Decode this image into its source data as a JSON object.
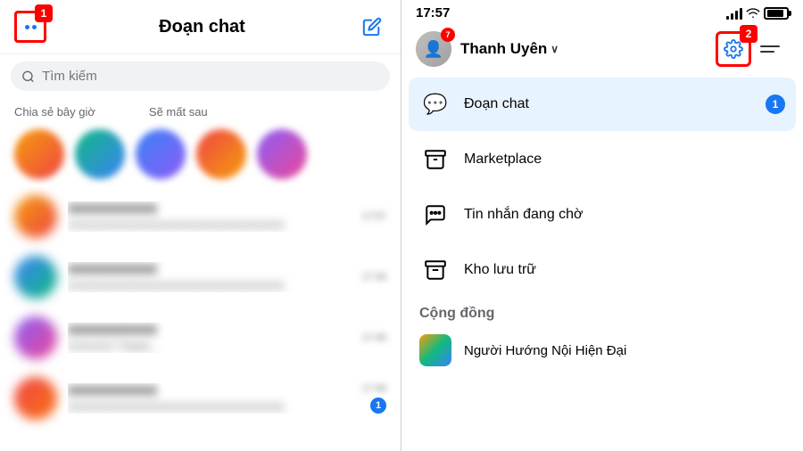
{
  "left": {
    "title": "Đoạn chat",
    "menu_badge": "1",
    "search_placeholder": "Tìm kiếm",
    "story_labels": [
      "Chia sẻ bây giờ",
      "Sẽ mất sau"
    ],
    "chat_items": [
      {
        "name": "xxxxxx",
        "preview": "xxxxxxxxxxxxxxxxxxxxxx",
        "time": "17:57",
        "unread": false
      },
      {
        "name": "xxxxxx",
        "preview": "xxxxxxxxxxxxxxxxxxxxxx",
        "time": "17:46",
        "unread": false
      },
      {
        "name": "xxxxxx",
        "preview": "xxxxxx Thành...",
        "time": "17:46",
        "unread": false
      },
      {
        "name": "xxxxxx",
        "preview": "xxxxxxxxxxxxxxxxxxxxxx",
        "time": "17:46",
        "unread": true
      }
    ]
  },
  "right": {
    "time": "17:57",
    "user_name": "Thanh Uyên",
    "user_badge": "7",
    "chevron": "∨",
    "nav_items": [
      {
        "icon": "💬",
        "label": "Đoạn chat",
        "badge": "1"
      },
      {
        "icon": "🏪",
        "label": "Marketplace",
        "badge": null
      },
      {
        "icon": "💬",
        "label": "Tin nhắn đang chờ",
        "badge": null
      },
      {
        "icon": "📦",
        "label": "Kho lưu trữ",
        "badge": null
      }
    ],
    "section_community": "Cộng đồng",
    "community_items": [
      {
        "label": "Người Hướng Nội Hiện Đại"
      }
    ]
  },
  "annotations": {
    "badge_1": "1",
    "badge_2": "2"
  }
}
